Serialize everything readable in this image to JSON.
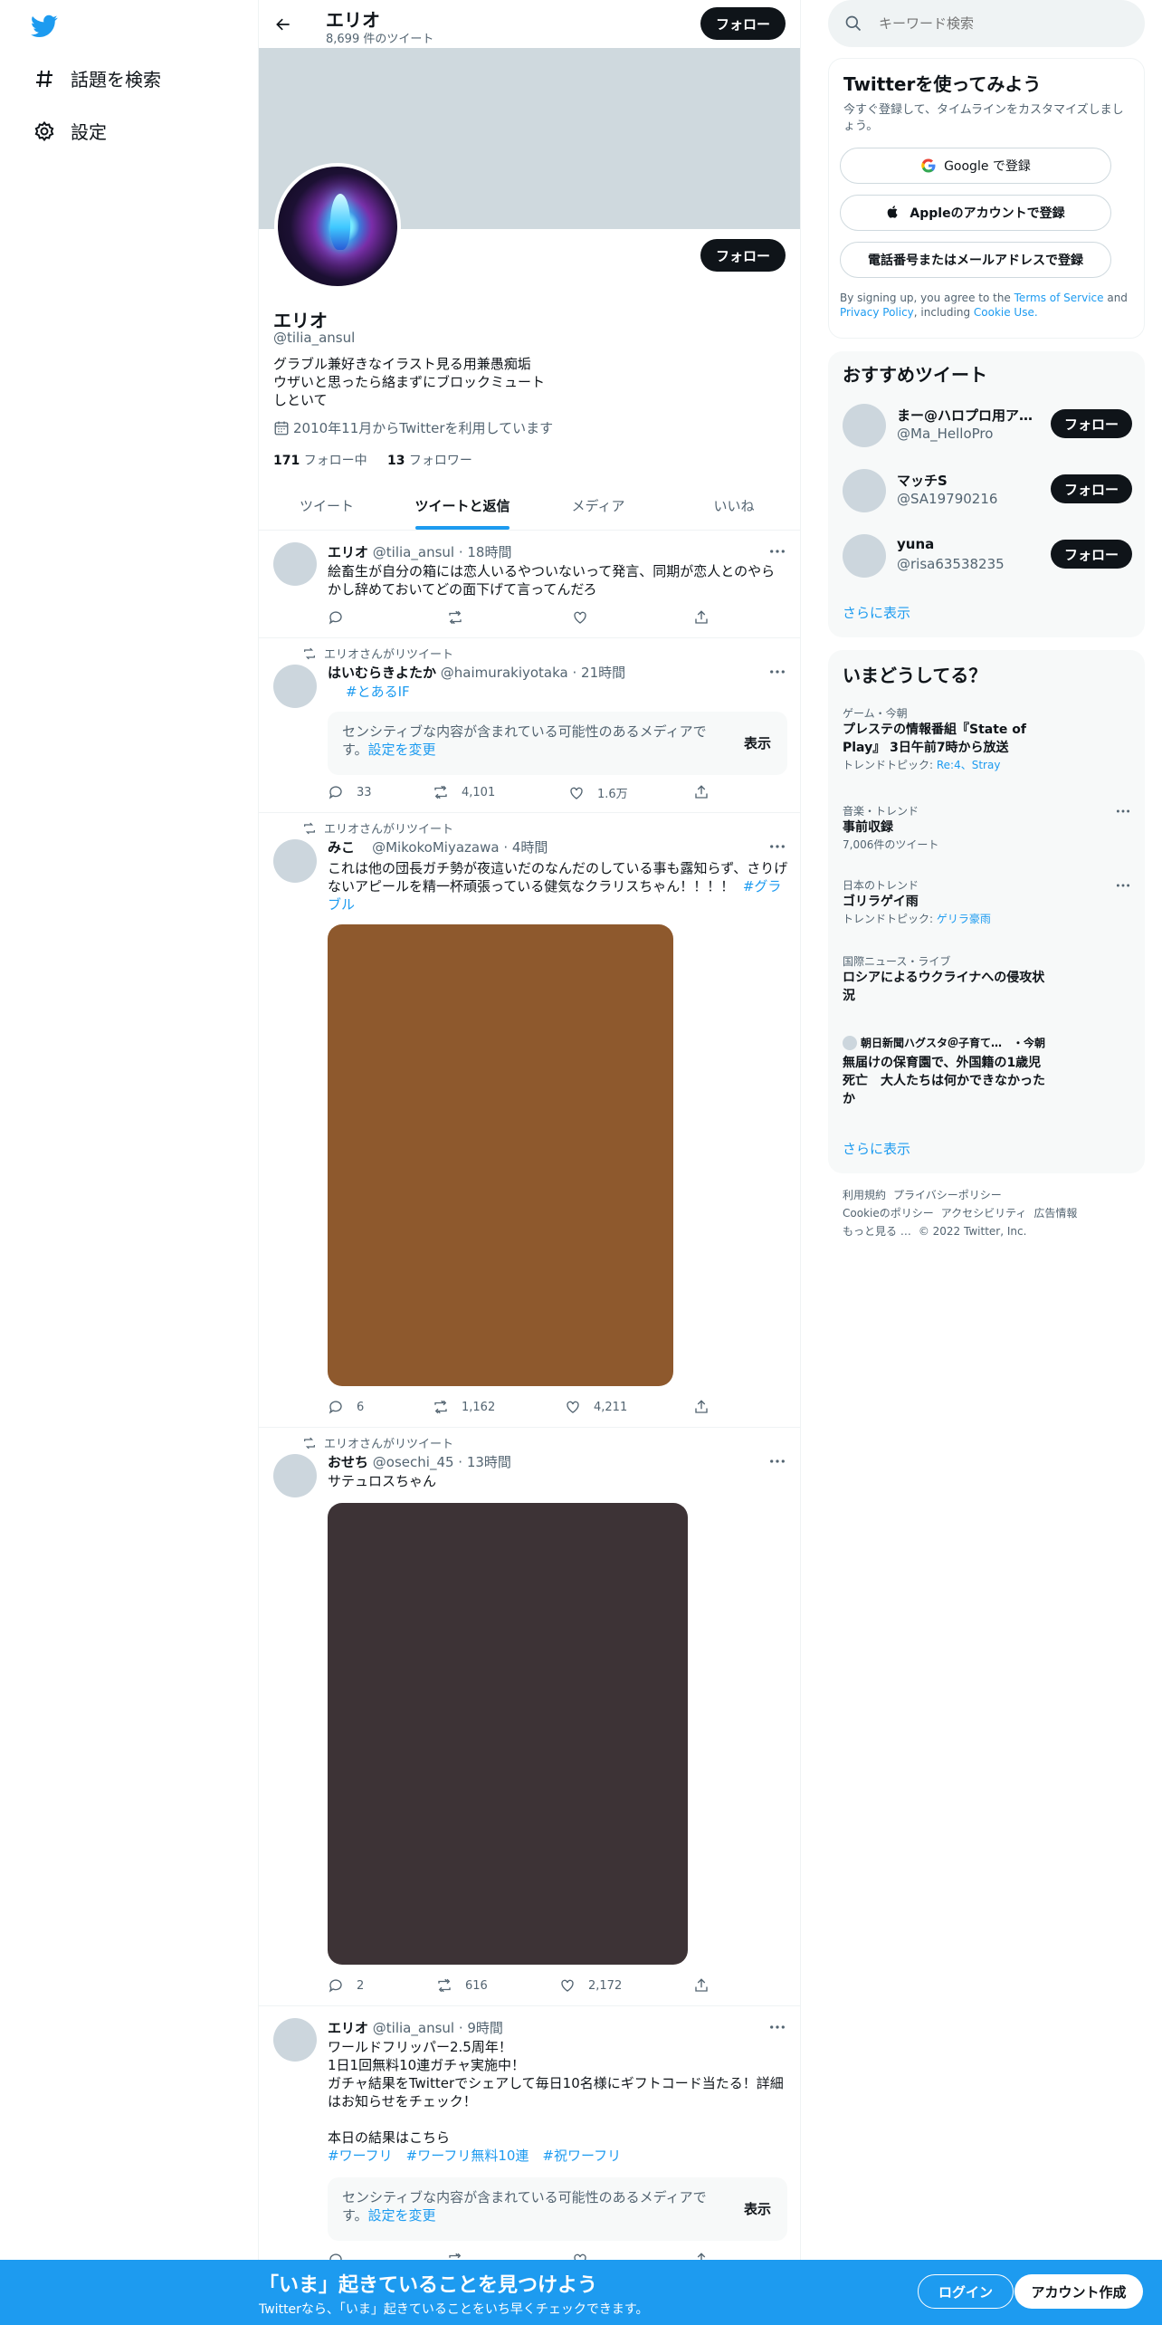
{
  "nav": {
    "explore_label": "話題を検索",
    "settings_label": "設定"
  },
  "header": {
    "name": "エリオ",
    "tweet_count": "8,699 件のツイート",
    "follow_label": "フォロー"
  },
  "profile": {
    "name": "エリオ",
    "handle": "@tilia_ansul",
    "bio": "グラブル兼好きなイラスト見る用兼愚痴垢 ウザいと思ったら絡まずにブロックミュートしといて",
    "joined": "2010年11月からTwitterを利用しています",
    "following_count": "171",
    "following_label": "フォロー中",
    "followers_count": "13",
    "followers_label": "フォロワー",
    "follow_label": "フォロー"
  },
  "tabs": [
    "ツイート",
    "ツイートと返信",
    "メディア",
    "いいね"
  ],
  "tweets": [
    {
      "name": "エリオ",
      "meta": "@tilia_ansul · 18時間",
      "text": "絵畜生が自分の箱には恋人いるやついないって発言、同期が恋人とのやらかし辞めておいてどの面下げて言ってんだろ",
      "replies": "",
      "retweets": "",
      "likes": ""
    },
    {
      "retweeted_by": "エリオさんがリツイート",
      "name": "はいむらきよたか",
      "meta": "@haimurakiyotaka · 21時間",
      "hashtag": "#とあるIF",
      "sensitive_text": "センシティブな内容が含まれている可能性のあるメディアです。",
      "sensitive_link": "設定を変更",
      "show_label": "表示",
      "replies": "33",
      "retweets": "4,101",
      "likes": "1.6万"
    },
    {
      "retweeted_by": "エリオさんがリツイート",
      "name": "みこ",
      "meta": "@MikokoMiyazawa · 4時間",
      "text": "これは他の団長ガチ勢が夜這いだのなんだのしている事も露知らず、さりげないアピールを精一杯頑張っている健気なクラリスちゃん！！！！",
      "hashtag": "#グラブル",
      "media_color": "#8e592d",
      "replies": "6",
      "retweets": "1,162",
      "likes": "4,211"
    },
    {
      "retweeted_by": "エリオさんがリツイート",
      "name": "おせち",
      "meta": "@osechi_45 · 13時間",
      "text": "サテュロスちゃん",
      "media_color": "#3d3336",
      "replies": "2",
      "retweets": "616",
      "likes": "2,172"
    },
    {
      "name": "エリオ",
      "meta": "@tilia_ansul · 9時間",
      "text_lines": [
        "ワールドフリッパー2.5周年！",
        "1日1回無料10連ガチャ実施中！",
        "ガチャ結果をTwitterでシェアして毎日10名様にギフトコード当たる！詳細はお知らせをチェック！",
        "",
        "本日の結果はこちら"
      ],
      "hashtags": "#ワーフリ　#ワーフリ無料10連　#祝ワーフリ",
      "sensitive_text": "センシティブな内容が含まれている可能性のあるメディアです。",
      "sensitive_link": "設定を変更",
      "show_label": "表示"
    }
  ],
  "search": {
    "placeholder": "キーワード検索"
  },
  "signup": {
    "title": "Twitterを使ってみよう",
    "subtitle": "今すぐ登録して、タイムラインをカスタマイズしましょう。",
    "google": "Google で登録",
    "apple": "Appleのアカウントで登録",
    "phone": "電話番号またはメールアドレスで登録",
    "legal_pre": "By signing up, you agree to the ",
    "terms": "Terms of Service",
    "and": " and ",
    "privacy": "Privacy Policy",
    "including": ", including ",
    "cookie": "Cookie Use."
  },
  "recommended": {
    "title": "おすすめツイート",
    "users": [
      {
        "name": "まー@ハロプロ用ア…",
        "handle": "@Ma_HelloPro"
      },
      {
        "name": "マッチS",
        "handle": "@SA19790216"
      },
      {
        "name": "yuna",
        "handle": "@risa63538235"
      }
    ],
    "follow_label": "フォロー",
    "more": "さらに表示"
  },
  "trends": {
    "title": "いまどうしてる？",
    "items": [
      {
        "context": "ゲーム・今朝",
        "title": "プレステの情報番組『State of Play』 3日午前7時から放送",
        "sub_label": "トレンドトピック: ",
        "sub_link": "Re:4、Stray"
      },
      {
        "context": "音楽・トレンド",
        "title": "事前収録",
        "sub_label": "7,006件のツイート",
        "sub_link": ""
      },
      {
        "context": "日本のトレンド",
        "title": "ゴリラゲイ雨",
        "sub_label": "トレンドトピック: ",
        "sub_link": "ゲリラ豪雨"
      },
      {
        "context": "国際ニュース・ライブ",
        "title": "ロシアによるウクライナへの侵攻状況",
        "sub_label": "",
        "sub_link": ""
      },
      {
        "context": "朝日新聞ハグスタ＠子育て…　・今朝",
        "title": "無届けの保育園で、外国籍の1歳児死亡　大人たちは何かできなかったか",
        "sub_label": "",
        "sub_link": ""
      }
    ],
    "more": "さらに表示"
  },
  "footer": {
    "links": [
      "利用規約",
      "プライバシーポリシー",
      "Cookieのポリシー",
      "アクセシビリティ",
      "広告情報",
      "もっと見る …",
      "© 2022 Twitter, Inc."
    ]
  },
  "bottom": {
    "title": "「いま」起きていることを見つけよう",
    "subtitle": "Twitterなら、「いま」起きていることをいち早くチェックできます。",
    "login": "ログイン",
    "signup": "アカウント作成"
  }
}
